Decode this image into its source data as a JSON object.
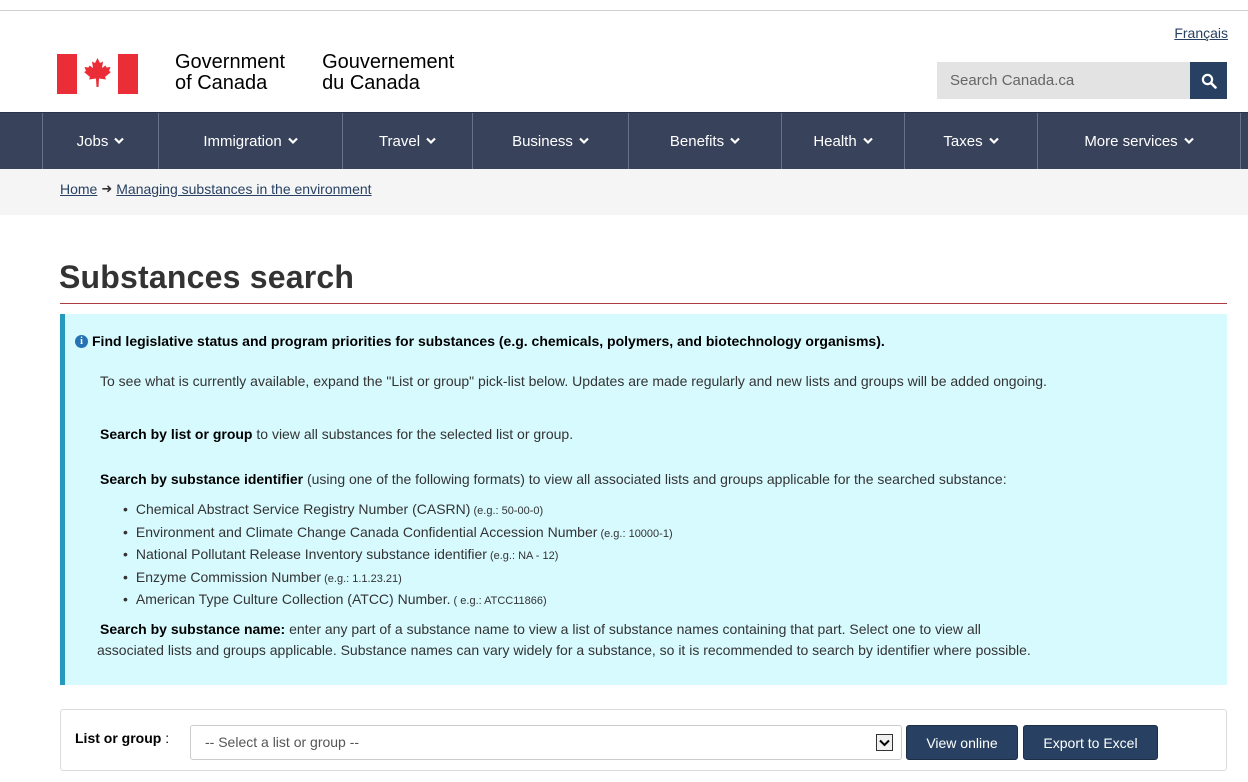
{
  "header": {
    "language_link": "Français",
    "wordmark_en_line1": "Government",
    "wordmark_en_line2": "of Canada",
    "wordmark_fr_line1": "Gouvernement",
    "wordmark_fr_line2": "du Canada",
    "search_placeholder": "Search Canada.ca"
  },
  "nav": {
    "items": [
      {
        "label": "Jobs"
      },
      {
        "label": "Immigration"
      },
      {
        "label": "Travel"
      },
      {
        "label": "Business"
      },
      {
        "label": "Benefits"
      },
      {
        "label": "Health"
      },
      {
        "label": "Taxes"
      },
      {
        "label": "More services"
      }
    ]
  },
  "breadcrumb": {
    "home": "Home",
    "current": "Managing substances in the environment"
  },
  "page": {
    "title": "Substances search"
  },
  "info": {
    "heading": "Find legislative status and program priorities for substances (e.g. chemicals, polymers, and biotechnology organisms).",
    "intro": "To see what is currently available, expand the \"List or group\" pick-list below. Updates are made regularly and new lists and groups will be added ongoing.",
    "by_list_bold": "Search by list or group",
    "by_list_text": " to view all substances for the selected list or group.",
    "by_identifier_bold": "Search by substance identifier",
    "by_identifier_text": " (using one of the following formats) to view all associated lists and groups applicable for the searched substance:",
    "identifiers": [
      {
        "name": "Chemical Abstract Service Registry Number (CASRN)",
        "example": " (e.g.: 50-00-0)"
      },
      {
        "name": "Environment and Climate Change Canada Confidential Accession Number",
        "example": " (e.g.: 10000-1)"
      },
      {
        "name": "National Pollutant Release Inventory substance identifier",
        "example": " (e.g.: NA - 12)"
      },
      {
        "name": "Enzyme Commission Number",
        "example": " (e.g.: 1.1.23.21)"
      },
      {
        "name": "American Type Culture Collection (ATCC) Number.",
        "example": " ( e.g.: ATCC11866)"
      }
    ],
    "by_name_bold": "Search by substance name:",
    "by_name_text_1": " enter any part of a substance name to view a list of substance names containing that part. Select one to view all",
    "by_name_text_2": "associated lists and groups applicable. Substance names can vary widely for a substance, so it is recommended to search by identifier where possible."
  },
  "form": {
    "label": "List or group",
    "label_suffix": " :",
    "select_value": "-- Select a list or group --",
    "view_online": "View online",
    "export_excel": "Export to Excel"
  },
  "colors": {
    "nav_bg": "#38425a",
    "brand_red": "#eb2d37",
    "button_blue": "#284162",
    "info_bg": "#d7faff",
    "info_border": "#269abc",
    "title_rule": "#af3c43"
  },
  "icons": {
    "search": "magnifier-icon",
    "chevron": "chevron-down-icon",
    "info": "info-circle-icon",
    "breadcrumb_arrow": "arrow-right-icon",
    "dropdown": "dropdown-arrow-icon"
  }
}
